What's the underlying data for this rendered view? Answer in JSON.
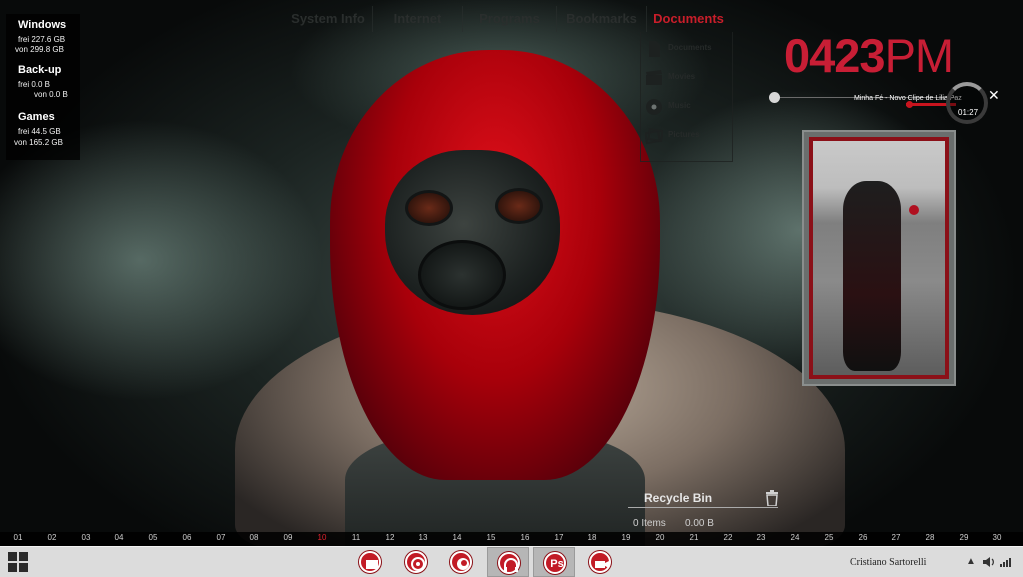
{
  "drives": [
    {
      "name": "Windows",
      "free": "frei 227.6 GB",
      "total": "von 299.8 GB"
    },
    {
      "name": "Back-up",
      "free": "frei 0.0 B",
      "total": "von 0.0 B"
    },
    {
      "name": "Games",
      "free": "frei 44.5 GB",
      "total": "von 165.2 GB"
    }
  ],
  "nav": {
    "tabs": [
      "System Info",
      "Internet",
      "Programs",
      "Bookmarks",
      "Documents"
    ],
    "active_tab": "Documents"
  },
  "documents_menu": [
    "Documents",
    "Movies",
    "Music",
    "Pictures"
  ],
  "clock": {
    "digits": "0423",
    "ampm": "PM"
  },
  "music": {
    "title": "Minha Fé - Novo Clipe de Lilia Paz",
    "time": "01:27"
  },
  "recycle_bin": {
    "title": "Recycle Bin",
    "items": "0 Items",
    "size": "0.00 B"
  },
  "calendar": {
    "days": [
      "01",
      "02",
      "03",
      "04",
      "05",
      "06",
      "07",
      "08",
      "09",
      "10",
      "11",
      "12",
      "13",
      "14",
      "15",
      "16",
      "17",
      "18",
      "19",
      "20",
      "21",
      "22",
      "23",
      "24",
      "25",
      "26",
      "27",
      "28",
      "29",
      "30"
    ],
    "today": "10"
  },
  "taskbar": {
    "user_name": "Cristiano Sartorelli",
    "apps": [
      "file-explorer-icon",
      "chrome-icon",
      "firefox-icon",
      "headphones-icon",
      "photoshop-icon",
      "video-camera-icon"
    ],
    "photoshop_label": "Ps"
  },
  "colors": {
    "accent": "#c81e2a",
    "taskbar": "#dcdcdc"
  }
}
